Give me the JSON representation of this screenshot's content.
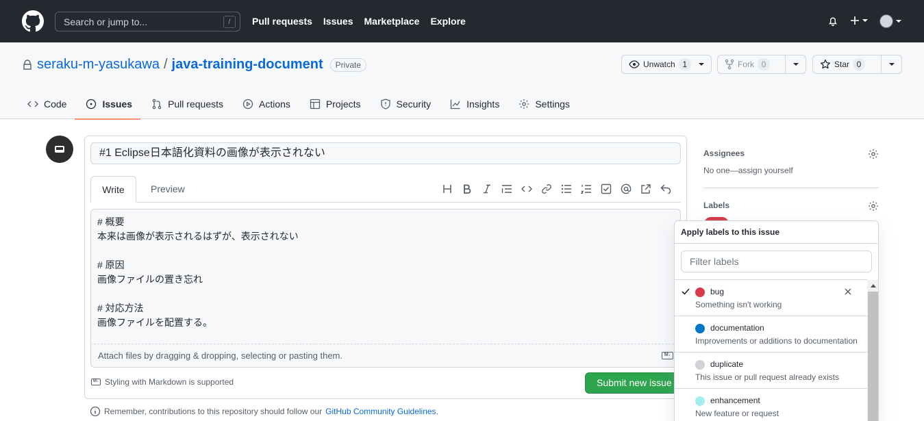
{
  "header": {
    "search_placeholder": "Search or jump to...",
    "search_key": "/",
    "nav": [
      "Pull requests",
      "Issues",
      "Marketplace",
      "Explore"
    ]
  },
  "repo": {
    "owner": "seraku-m-yasukawa",
    "separator": "/",
    "name": "java-training-document",
    "visibility": "Private",
    "unwatch_label": "Unwatch",
    "unwatch_count": "1",
    "fork_label": "Fork",
    "fork_count": "0",
    "star_label": "Star",
    "star_count": "0",
    "tabs": [
      {
        "label": "Code",
        "icon": "code-icon"
      },
      {
        "label": "Issues",
        "icon": "issue-opened-icon",
        "active": true
      },
      {
        "label": "Pull requests",
        "icon": "git-pull-request-icon"
      },
      {
        "label": "Actions",
        "icon": "play-icon"
      },
      {
        "label": "Projects",
        "icon": "table-icon"
      },
      {
        "label": "Security",
        "icon": "shield-icon"
      },
      {
        "label": "Insights",
        "icon": "graph-icon"
      },
      {
        "label": "Settings",
        "icon": "gear-icon"
      }
    ]
  },
  "issue_form": {
    "title_value": "#1 Eclipse日本語化資料の画像が表示されない",
    "write_tab": "Write",
    "preview_tab": "Preview",
    "body_lines": [
      "# 概要",
      "本来は画像が表示されるはずが、表示されない",
      "",
      "# 原因",
      "画像ファイルの置き忘れ",
      "",
      "# 対応方法",
      "画像ファイルを配置する。"
    ],
    "attach_text": "Attach files by dragging & dropping, selecting or pasting them.",
    "markdown_support": "Styling with Markdown is supported",
    "submit_label": "Submit new issue",
    "guidelines_text": "Remember, contributions to this repository should follow our",
    "guidelines_link": "GitHub Community Guidelines",
    "guidelines_end": "."
  },
  "sidebar": {
    "assignees_head": "Assignees",
    "assignees_text": "No one—assign yourself",
    "labels_head": "Labels"
  },
  "labels_popover": {
    "title": "Apply labels to this issue",
    "filter_placeholder": "Filter labels",
    "items": [
      {
        "name": "bug",
        "desc": "Something isn't working",
        "color": "#d73a4a",
        "checked": true
      },
      {
        "name": "documentation",
        "desc": "Improvements or additions to documentation",
        "color": "#0075ca",
        "checked": false
      },
      {
        "name": "duplicate",
        "desc": "This issue or pull request already exists",
        "color": "#cfd3d7",
        "checked": false
      },
      {
        "name": "enhancement",
        "desc": "New feature or request",
        "color": "#a2eeef",
        "checked": false
      }
    ]
  },
  "colors": {
    "header_bg": "#24292f",
    "link": "#0969da",
    "submit": "#2da44e",
    "active_tab_underline": "#fd8c73"
  }
}
